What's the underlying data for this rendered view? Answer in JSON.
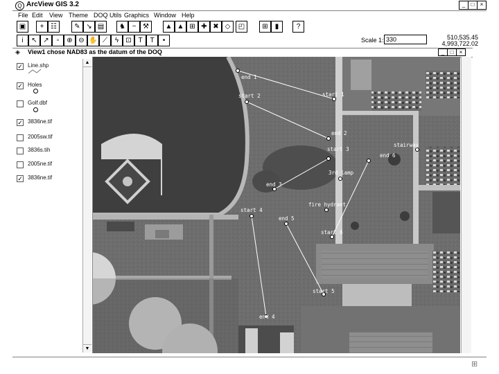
{
  "app": {
    "title": "ArcView GIS 3.2"
  },
  "menus": [
    "File",
    "Edit",
    "View",
    "Theme",
    "DOQ Utils",
    "Graphics",
    "Window",
    "Help"
  ],
  "scale": {
    "label": "Scale 1:",
    "value": "330"
  },
  "coords": {
    "x": "510,535.45",
    "y": "4,993,722.02"
  },
  "view": {
    "title": "View1  chose NAD83 as the datum of the DOQ"
  },
  "layers": [
    {
      "name": "Line.shp",
      "checked": true
    },
    {
      "name": "Holes",
      "checked": true
    },
    {
      "name": "Golf.dbf",
      "checked": false
    },
    {
      "name": "3836ne.tif",
      "checked": true
    },
    {
      "name": "2005sw.tif",
      "checked": false
    },
    {
      "name": "3836s.tih",
      "checked": false
    },
    {
      "name": "2005ne.tif",
      "checked": false
    },
    {
      "name": "3836ne.tif",
      "checked": true
    }
  ],
  "map_labels": [
    "end 1",
    "start 1",
    "start 2",
    "end 2",
    "start 3",
    "stairway",
    "end 6",
    "3rd lamp",
    "end 3",
    "fire hydrant",
    "start 4",
    "end 5",
    "start 6",
    "start 5",
    "end 4"
  ]
}
